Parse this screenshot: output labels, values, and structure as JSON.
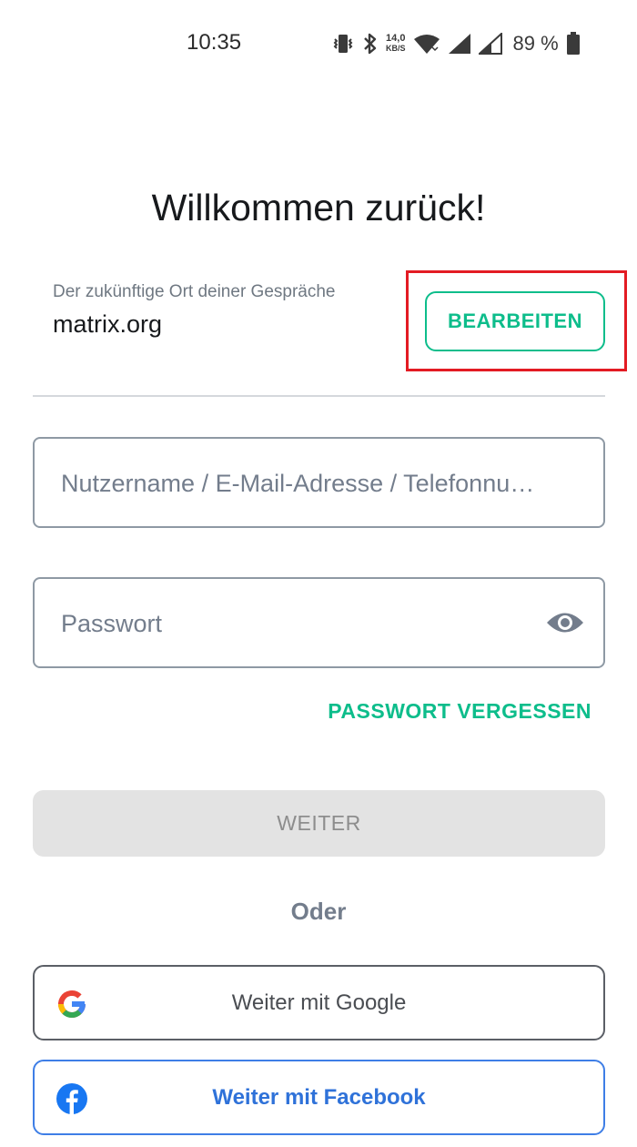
{
  "status_bar": {
    "time": "10:35",
    "net_speed_value": "14,0",
    "net_speed_unit": "KB/S",
    "battery": "89 %"
  },
  "title": "Willkommen zurück!",
  "server": {
    "caption": "Der zukünftige Ort deiner Gespräche",
    "name": "matrix.org",
    "edit_label": "BEARBEITEN"
  },
  "form": {
    "username_placeholder": "Nutzername / E-Mail-Adresse / Telefonnu…",
    "password_placeholder": "Passwort",
    "forgot_label": "PASSWORT VERGESSEN",
    "continue_label": "WEITER"
  },
  "or_label": "Oder",
  "sso": {
    "google_label": "Weiter mit Google",
    "facebook_label": "Weiter mit Facebook"
  },
  "colors": {
    "accent": "#0dbd8b",
    "highlight": "#e31b23",
    "facebook": "#1877f2"
  }
}
